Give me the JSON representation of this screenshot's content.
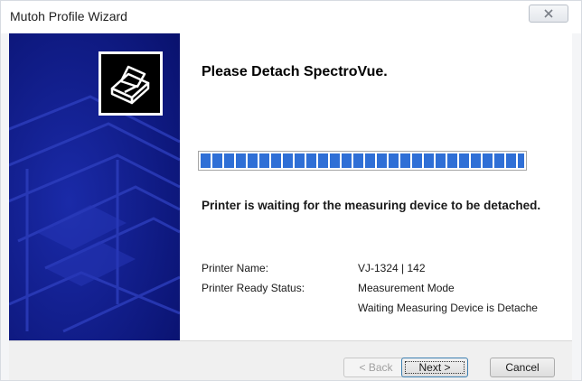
{
  "window": {
    "title": "Mutoh Profile Wizard",
    "close_icon": "close-icon"
  },
  "banner": {
    "icon": "printer-icon",
    "colors": {
      "background": "#0d1a8a",
      "accent": "#2b3bb0"
    }
  },
  "main": {
    "heading": "Please Detach SpectroVue.",
    "progress": {
      "segments_filled": 27,
      "segments_total": 27,
      "fraction": 1.0,
      "color": "#2f6fd6"
    },
    "status_message": "Printer is waiting for the measuring device to be detached.",
    "info": {
      "printer_name_label": "Printer Name:",
      "printer_name_value": "VJ-1324 | 142",
      "ready_status_label": "Printer Ready Status:",
      "ready_status_value_1": "Measurement Mode",
      "ready_status_value_2": "Waiting Measuring Device is Detache"
    }
  },
  "footer": {
    "back_label": "< Back",
    "next_label": "Next >",
    "cancel_label": "Cancel"
  }
}
